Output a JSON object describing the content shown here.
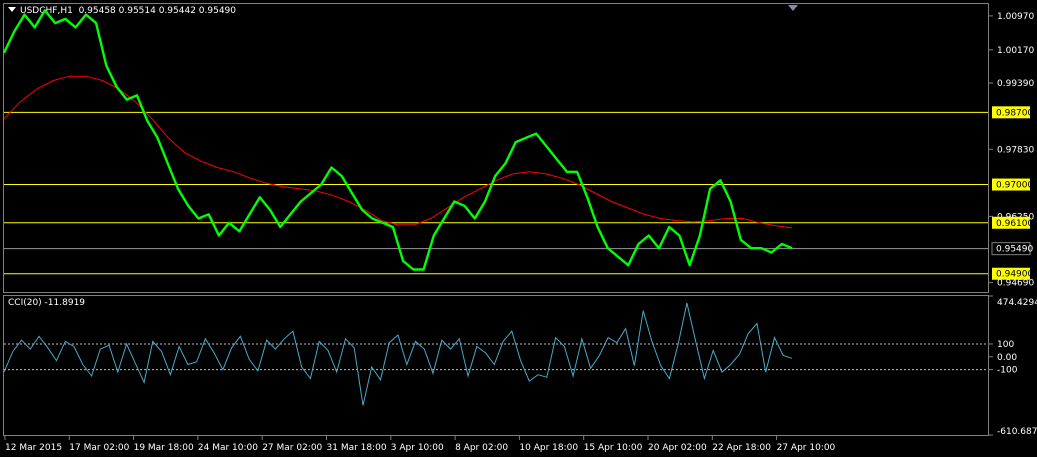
{
  "window": {
    "title": "USDCHF,H1",
    "ohlc": "0.95458 0.95514 0.95442 0.95490",
    "indicator_title": "CCI(20) -11.8919"
  },
  "colors": {
    "background": "#000000",
    "price_line": "#00ff00",
    "moving_average": "#ff0000",
    "horizontal_levels": "#ffff00",
    "cci_line": "#4aa8c8",
    "grid_dotted": "#c0c0c0"
  },
  "chart_data": [
    {
      "type": "line",
      "name": "price",
      "title": "USDCHF,H1",
      "y_ticks": [
        "1.00970",
        "1.00170",
        "0.99390",
        "0.97830",
        "0.96250",
        "0.94690"
      ],
      "ylim": [
        0.9447,
        1.0125
      ],
      "current_price": "0.95490",
      "horizontal_levels": [
        "0.98700",
        "0.97000",
        "0.96100",
        "0.94900"
      ],
      "x_ticks": [
        "12 Mar 2015",
        "17 Mar 02:00",
        "19 Mar 18:00",
        "24 Mar 10:00",
        "27 Mar 02:00",
        "31 Mar 18:00",
        "3 Apr 10:00",
        "8 Apr 02:00",
        "10 Apr 18:00",
        "15 Apr 10:00",
        "20 Apr 02:00",
        "22 Apr 18:00",
        "27 Apr 10:00"
      ],
      "series": [
        {
          "name": "",
          "style": "price",
          "values": [
            1.001,
            1.006,
            1.01,
            1.007,
            1.011,
            1.008,
            1.009,
            1.007,
            1.01,
            1.008,
            0.998,
            0.993,
            0.99,
            0.991,
            0.985,
            0.981,
            0.975,
            0.969,
            0.965,
            0.962,
            0.963,
            0.958,
            0.961,
            0.959,
            0.963,
            0.967,
            0.964,
            0.96,
            0.963,
            0.966,
            0.968,
            0.97,
            0.974,
            0.972,
            0.968,
            0.964,
            0.962,
            0.961,
            0.96,
            0.952,
            0.95,
            0.95,
            0.958,
            0.962,
            0.966,
            0.965,
            0.962,
            0.966,
            0.972,
            0.975,
            0.98,
            0.981,
            0.982,
            0.979,
            0.976,
            0.973,
            0.973,
            0.967,
            0.96,
            0.955,
            0.953,
            0.951,
            0.956,
            0.958,
            0.955,
            0.96,
            0.958,
            0.951,
            0.958,
            0.969,
            0.971,
            0.966,
            0.957,
            0.955,
            0.955,
            0.954,
            0.956,
            0.955
          ]
        },
        {
          "name": "",
          "style": "moving-average",
          "values": [
            0.9855,
            0.9895,
            0.9925,
            0.9945,
            0.9955,
            0.9955,
            0.9945,
            0.9925,
            0.9895,
            0.9855,
            0.981,
            0.9775,
            0.9755,
            0.974,
            0.973,
            0.9715,
            0.9703,
            0.9695,
            0.969,
            0.9685,
            0.9675,
            0.966,
            0.964,
            0.9615,
            0.9605,
            0.9605,
            0.962,
            0.9645,
            0.967,
            0.969,
            0.971,
            0.9725,
            0.973,
            0.9725,
            0.9715,
            0.97,
            0.968,
            0.966,
            0.9645,
            0.963,
            0.962,
            0.9615,
            0.9612,
            0.9615,
            0.962,
            0.962,
            0.961,
            0.9603,
            0.9598
          ]
        }
      ]
    },
    {
      "type": "line",
      "name": "CCI",
      "title": "CCI(20) -11.8919",
      "y_ticks": [
        "474.4294",
        "100",
        "0.00",
        "-100",
        "-610.6873"
      ],
      "ylim": [
        -610.6873,
        474.4294
      ],
      "levels": [
        100,
        -100
      ],
      "series": [
        {
          "name": "",
          "values": [
            -120,
            40,
            130,
            60,
            160,
            70,
            -30,
            120,
            80,
            -60,
            -150,
            60,
            90,
            -120,
            100,
            -50,
            -200,
            120,
            40,
            -140,
            80,
            -60,
            -40,
            140,
            30,
            -100,
            70,
            160,
            -20,
            -110,
            130,
            60,
            140,
            200,
            -80,
            -170,
            120,
            50,
            -120,
            140,
            70,
            -380,
            -80,
            -180,
            110,
            170,
            -60,
            120,
            60,
            -130,
            130,
            60,
            140,
            -150,
            80,
            30,
            -60,
            120,
            200,
            -30,
            -190,
            -140,
            -160,
            150,
            80,
            -150,
            140,
            -90,
            10,
            150,
            110,
            220,
            -70,
            360,
            120,
            -70,
            -170,
            100,
            420,
            120,
            -170,
            50,
            -120,
            -60,
            20,
            180,
            260,
            -120,
            150,
            10,
            -12
          ]
        }
      ]
    }
  ]
}
